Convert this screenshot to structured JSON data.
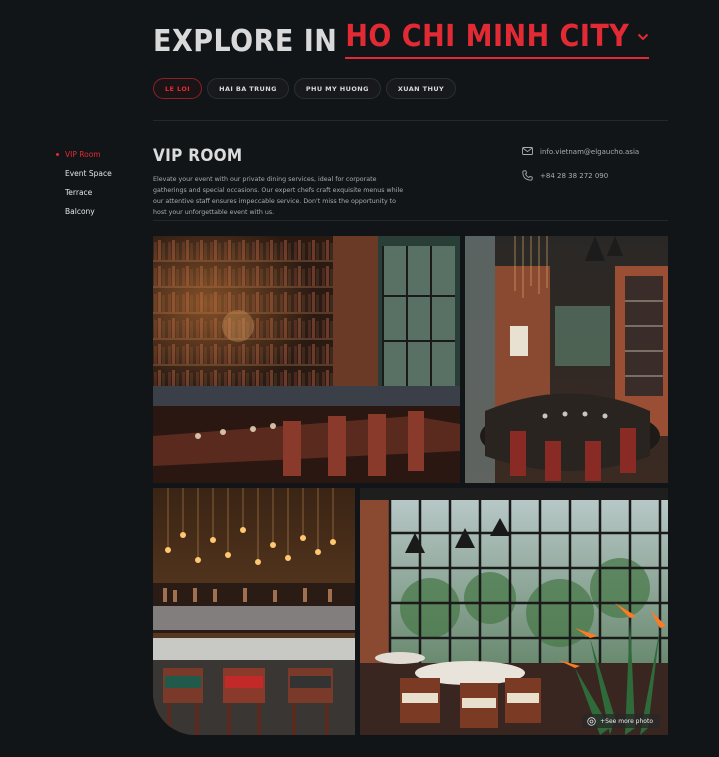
{
  "header": {
    "title_prefix": "EXPLORE IN",
    "city": "HO CHI MINH CITY"
  },
  "tabs": [
    {
      "label": "LE LOI",
      "active": true
    },
    {
      "label": "HAI BA TRUNG",
      "active": false
    },
    {
      "label": "PHU MY HUONG",
      "active": false
    },
    {
      "label": "XUAN THUY",
      "active": false
    }
  ],
  "sidebar": {
    "items": [
      {
        "label": "VIP Room",
        "active": true
      },
      {
        "label": "Event Space",
        "active": false
      },
      {
        "label": "Terrace",
        "active": false
      },
      {
        "label": "Balcony",
        "active": false
      }
    ]
  },
  "section": {
    "title": "VIP ROOM",
    "description": "Elevate your event with our private dining services, ideal for corporate gatherings and special occasions. Our expert chefs craft exquisite menus while our attentive staff ensures impeccable service. Don't miss the opportunity to host your unforgettable event with us."
  },
  "contact": {
    "email": "info.vietnam@elgaucho.asia",
    "phone": "+84 28 38 272 090"
  },
  "gallery": {
    "see_more": "+See more photo"
  },
  "icons": {
    "city_dropdown": "chevron-down-icon",
    "email": "mail-icon",
    "phone": "phone-icon",
    "see_more": "camera-icon"
  },
  "colors": {
    "accent": "#e22a35",
    "background": "#121518"
  }
}
